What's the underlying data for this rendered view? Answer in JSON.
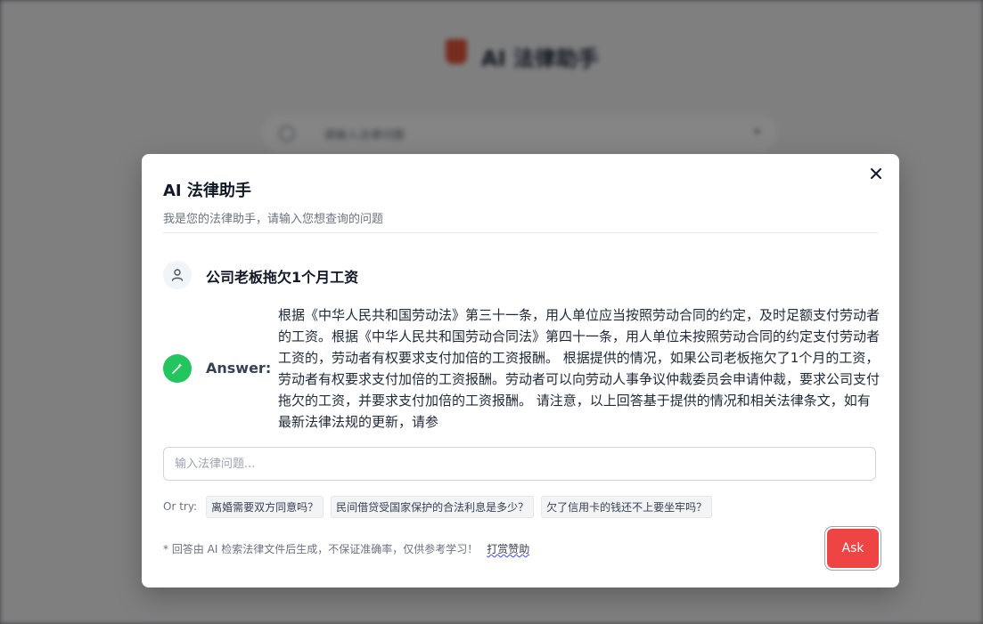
{
  "background": {
    "app_title": "AI 法律助手",
    "search_placeholder": "请输入法律问题",
    "search_right": "▾"
  },
  "modal": {
    "title": "AI 法律助手",
    "subtitle": "我是您的法律助手，请输入您想查询的问题",
    "close_icon": "close-icon",
    "question": "公司老板拖欠1个月工资",
    "answer_label": "Answer:",
    "answer_text": "根据《中华人民共和国劳动法》第三十一条，用人单位应当按照劳动合同的约定，及时足额支付劳动者的工资。根据《中华人民共和国劳动合同法》第四十一条，用人单位未按照劳动合同的约定支付劳动者工资的，劳动者有权要求支付加倍的工资报酬。 根据提供的情况，如果公司老板拖欠了1个月的工资，劳动者有权要求支付加倍的工资报酬。劳动者可以向劳动人事争议仲裁委员会申请仲裁，要求公司支付拖欠的工资，并要求支付加倍的工资报酬。 请注意，以上回答基于提供的情况和相关法律条文，如有最新法律法规的更新，请参",
    "input_placeholder": "输入法律问题...",
    "input_value": "",
    "try_label": "Or try:",
    "suggestions": [
      "离婚需要双方同意吗？",
      "民间借贷受国家保护的合法利息是多少？",
      "欠了信用卡的钱还不上要坐牢吗？"
    ],
    "footnote": "* 回答由 AI 检索法律文件后生成，不保证准确率，仅供参考学习！",
    "sponsor_link": "打赏赞助",
    "ask_label": "Ask"
  },
  "colors": {
    "accent_red": "#ef4444",
    "bot_green": "#22c55e"
  }
}
